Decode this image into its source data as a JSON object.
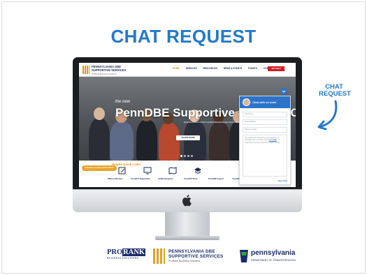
{
  "slide": {
    "title": "CHAT REQUEST",
    "annotation": [
      "CHAT",
      "REQUEST"
    ]
  },
  "website": {
    "logo": {
      "line1": "PENNSYLVANIA DBE",
      "line2": "SUPPORTIVE SERVICES",
      "tagline": "ProRank Business Solutions"
    },
    "nav": [
      "HOME",
      "SERVICES",
      "RESOURCES",
      "NEWS & EVENTS",
      "EVENTS",
      "CONTACT"
    ],
    "nav_cta": "GET HELP",
    "hero": {
      "small": "the new",
      "headline": "PennDBE Supportive Services C",
      "caption": "Dedicated to PennDOT-Certified Disadvantaged Business Enterprises",
      "button": "LEARN MORE"
    },
    "quicklinks_title": "Helpful Quick Links",
    "quicklinks": [
      "DBE Certification",
      "PennDOT Registration",
      "ECMS Navigation",
      "PennDOT Plans",
      "PennDBE Support",
      "PennDBE University",
      "Request Assistance"
    ],
    "schedule_button": "Schedule a meeting with ProRank",
    "chat": {
      "title": "Chat with us now!",
      "name_placeholder": "Full Name",
      "email_placeholder": "Email address",
      "phone_placeholder": "Phone number",
      "message_text": "We would love to hear from you! Send us a message and a member of the",
      "message_link": "PennDBE",
      "message_text2": "Supportive Services team will respond shortly.",
      "start_button": "Start Chat"
    }
  },
  "footer_logos": {
    "prorank": {
      "pre": "PRO",
      "boxed": "RANK",
      "sub": "BUSINESS SOLUTIONS"
    },
    "pa_dbe": {
      "line1": "PENNSYLVANIA DBE",
      "line2": "SUPPORTIVE SERVICES",
      "tag": "ProRank Business Solutions"
    },
    "penndot": {
      "name": "pennsylvania",
      "dept": "DEPARTMENT OF TRANSPORTATION"
    }
  },
  "colors": {
    "title_blue": "#2479c8",
    "chat_blue": "#2d74c9",
    "gold": "#d79a1f",
    "navy": "#1b2c6a"
  }
}
